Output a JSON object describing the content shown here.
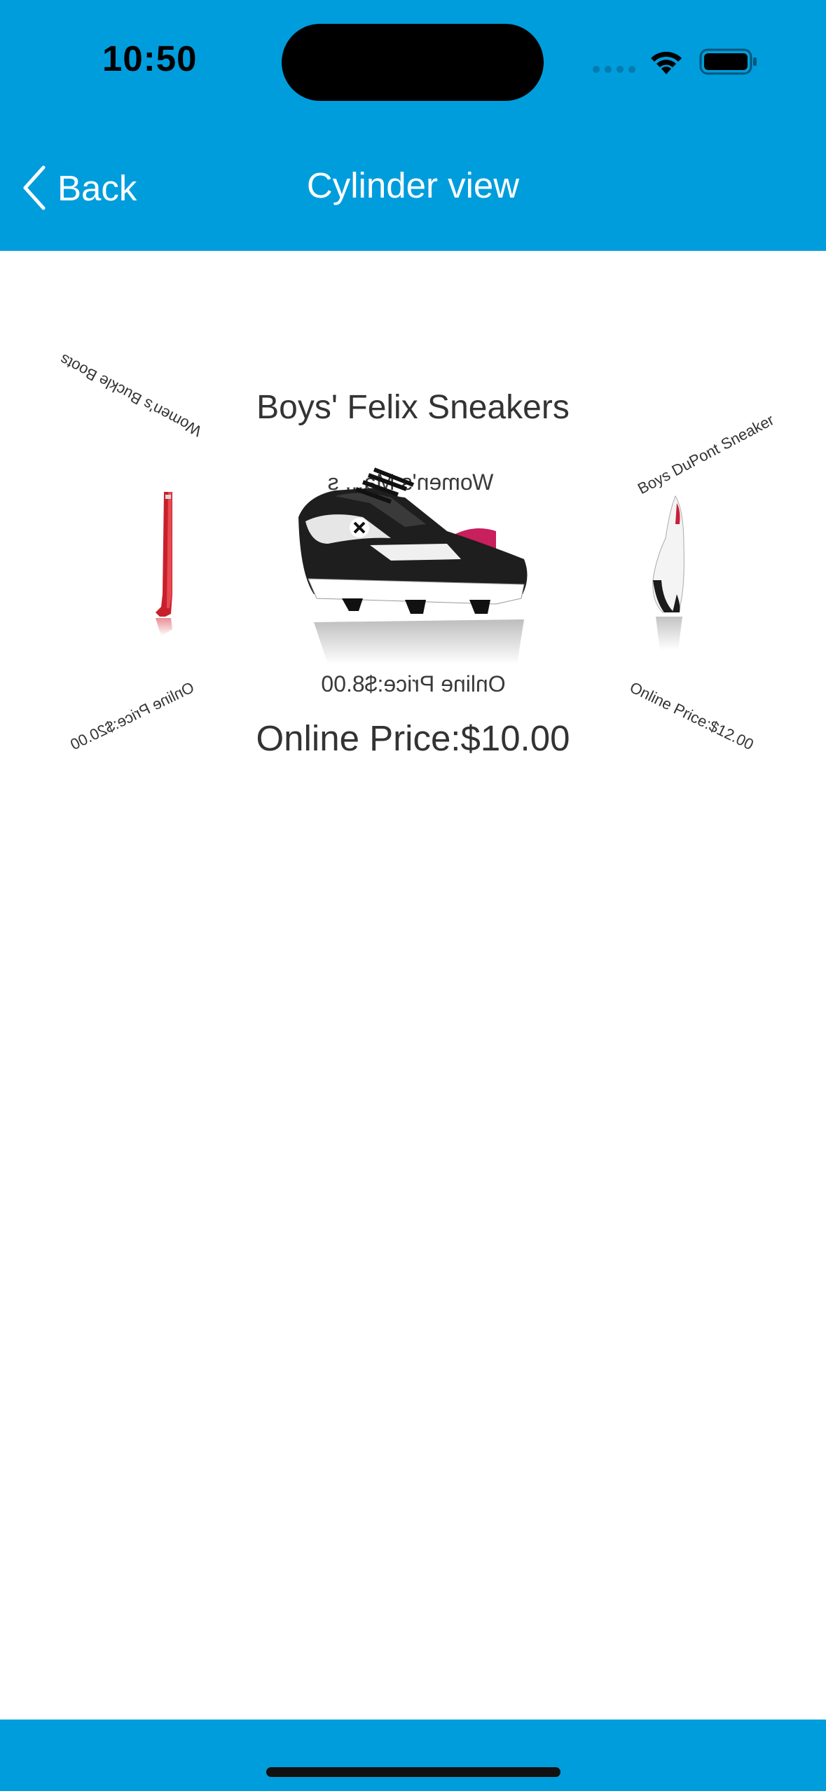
{
  "status_bar": {
    "time": "10:50"
  },
  "nav": {
    "back_label": "Back",
    "title": "Cylinder view",
    "bar_color": "#009ddd"
  },
  "carousel": {
    "center_item": {
      "title": "Boys' Felix Sneakers",
      "price": "Online Price:$10.00"
    },
    "back_item": {
      "title": "Women's Ma... s",
      "price": "Online Price:$8.00"
    },
    "left_item": {
      "title": "Women's Buckle Boots",
      "price": "Online Price:$20.00"
    },
    "right_item": {
      "title": "Boys DuPont Sneaker",
      "price": "Online Price:$12.00"
    }
  },
  "icons": {
    "back": "chevron-left-icon",
    "wifi": "wifi-icon",
    "battery": "battery-icon"
  }
}
